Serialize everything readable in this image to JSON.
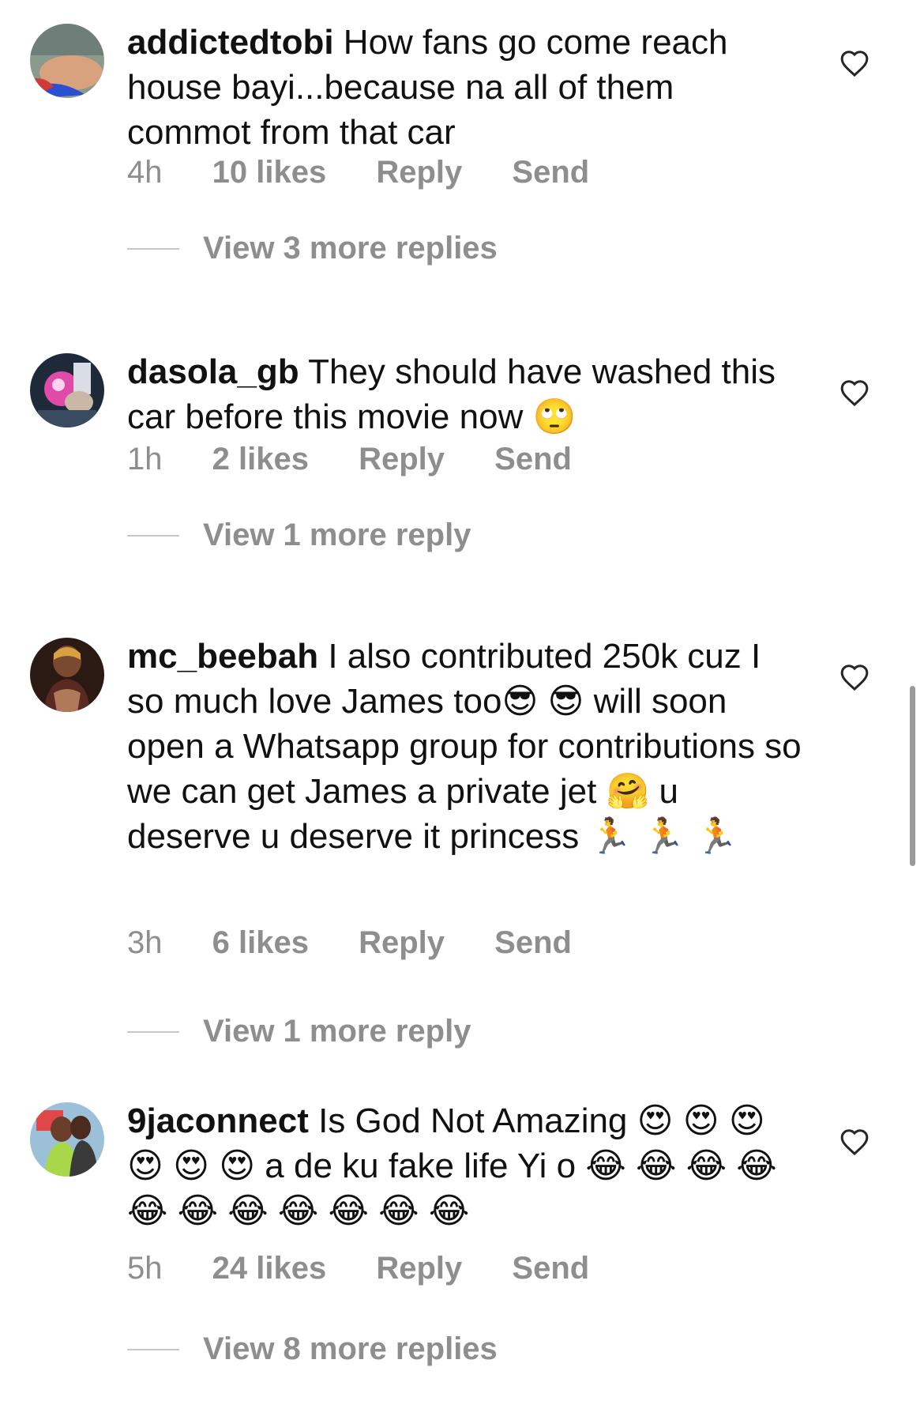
{
  "comments": [
    {
      "username": "addictedtobi",
      "text": "How fans go come reach house bayi...because na all of them commot from that car",
      "time": "4h",
      "likes": "10 likes",
      "reply_label": "Reply",
      "send_label": "Send",
      "view_replies": "View 3 more replies"
    },
    {
      "username": "dasola_gb",
      "text": "They should have washed this car before this movie now 🙄",
      "time": "1h",
      "likes": "2 likes",
      "reply_label": "Reply",
      "send_label": "Send",
      "view_replies": "View 1 more reply"
    },
    {
      "username": "mc_beebah",
      "text": "I also contributed 250k cuz I so much love James too😎 😎 will soon open a Whatsapp group for contributions so we can get James a private jet 🤗 u deserve u deserve it princess 🏃 🏃 🏃",
      "time": "3h",
      "likes": "6 likes",
      "reply_label": "Reply",
      "send_label": "Send",
      "view_replies": "View 1 more reply"
    },
    {
      "username": "9jaconnect",
      "text": "Is God Not Amazing 😍 😍 😍 😍 😍 😍 a de ku fake life Yi o 😂 😂 😂 😂 😂 😂 😂 😂 😂 😂 😂",
      "time": "5h",
      "likes": "24 likes",
      "reply_label": "Reply",
      "send_label": "Send",
      "view_replies": "View 8 more replies"
    }
  ],
  "colors": {
    "text": "#111111",
    "secondary": "#8e8e8e",
    "divider": "#c7c7c7"
  },
  "icons": {
    "like": "heart-outline-icon"
  }
}
